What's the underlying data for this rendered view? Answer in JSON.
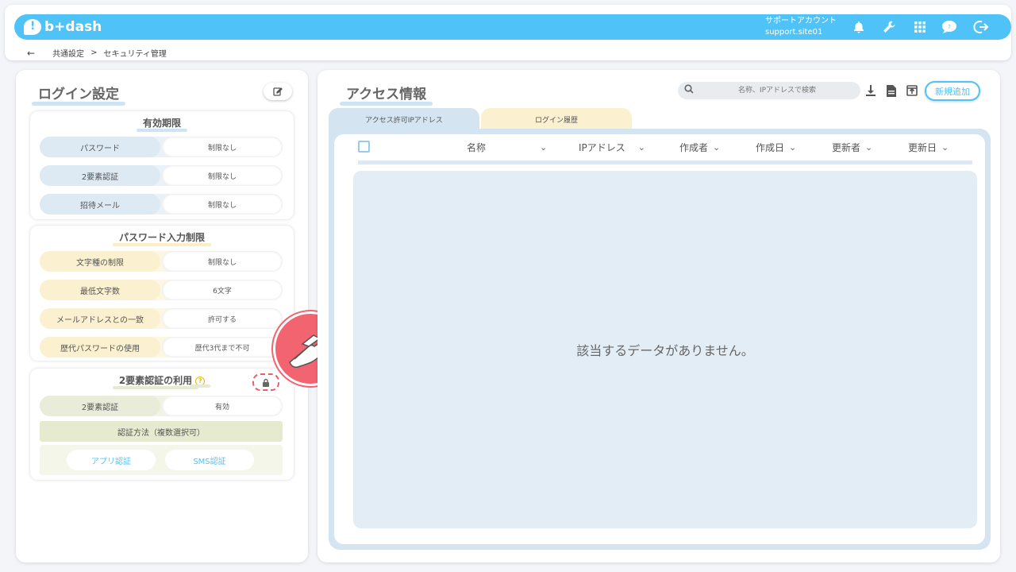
{
  "header": {
    "logo_text": "b+dash",
    "account_label": "サポートアカウント",
    "account_id": "support.site01",
    "icons": [
      "bell-icon",
      "wrench-icon",
      "grid-icon",
      "chat-bubble-icon",
      "logout-icon"
    ]
  },
  "breadcrumb": {
    "back": "←",
    "parent": "共通設定",
    "separator": ">",
    "current": "セキュリティ管理"
  },
  "login_settings": {
    "title": "ログイン設定",
    "expiry": {
      "title": "有効期限",
      "rows": [
        {
          "label": "パスワード",
          "value": "制限なし"
        },
        {
          "label": "2要素認証",
          "value": "制限なし"
        },
        {
          "label": "招待メール",
          "value": "制限なし"
        }
      ]
    },
    "password_limits": {
      "title": "パスワード入力制限",
      "rows": [
        {
          "label": "文字種の制限",
          "value": "制限なし"
        },
        {
          "label": "最低文字数",
          "value": "6文字"
        },
        {
          "label": "メールアドレスとの一致",
          "value": "許可する"
        },
        {
          "label": "歴代パスワードの使用",
          "value": "歴代3代まで不可"
        }
      ]
    },
    "two_factor": {
      "title": "2要素認証の利用",
      "help": "?",
      "row": {
        "label": "2要素認証",
        "value": "有効"
      },
      "method_label": "認証方法（複数選択可）",
      "methods": [
        "アプリ認証",
        "SMS認証"
      ]
    }
  },
  "access_info": {
    "title": "アクセス情報",
    "search_placeholder": "名称、IPアドレスで検索",
    "new_button": "新規追加",
    "tabs": [
      "アクセス許可IPアドレス",
      "ログイン履歴"
    ],
    "columns": [
      "名称",
      "IPアドレス",
      "作成者",
      "作成日",
      "更新者",
      "更新日"
    ],
    "empty_message": "該当するデータがありません。"
  },
  "colors": {
    "brand": "#4fc3f7",
    "pointer": "#f16470"
  }
}
